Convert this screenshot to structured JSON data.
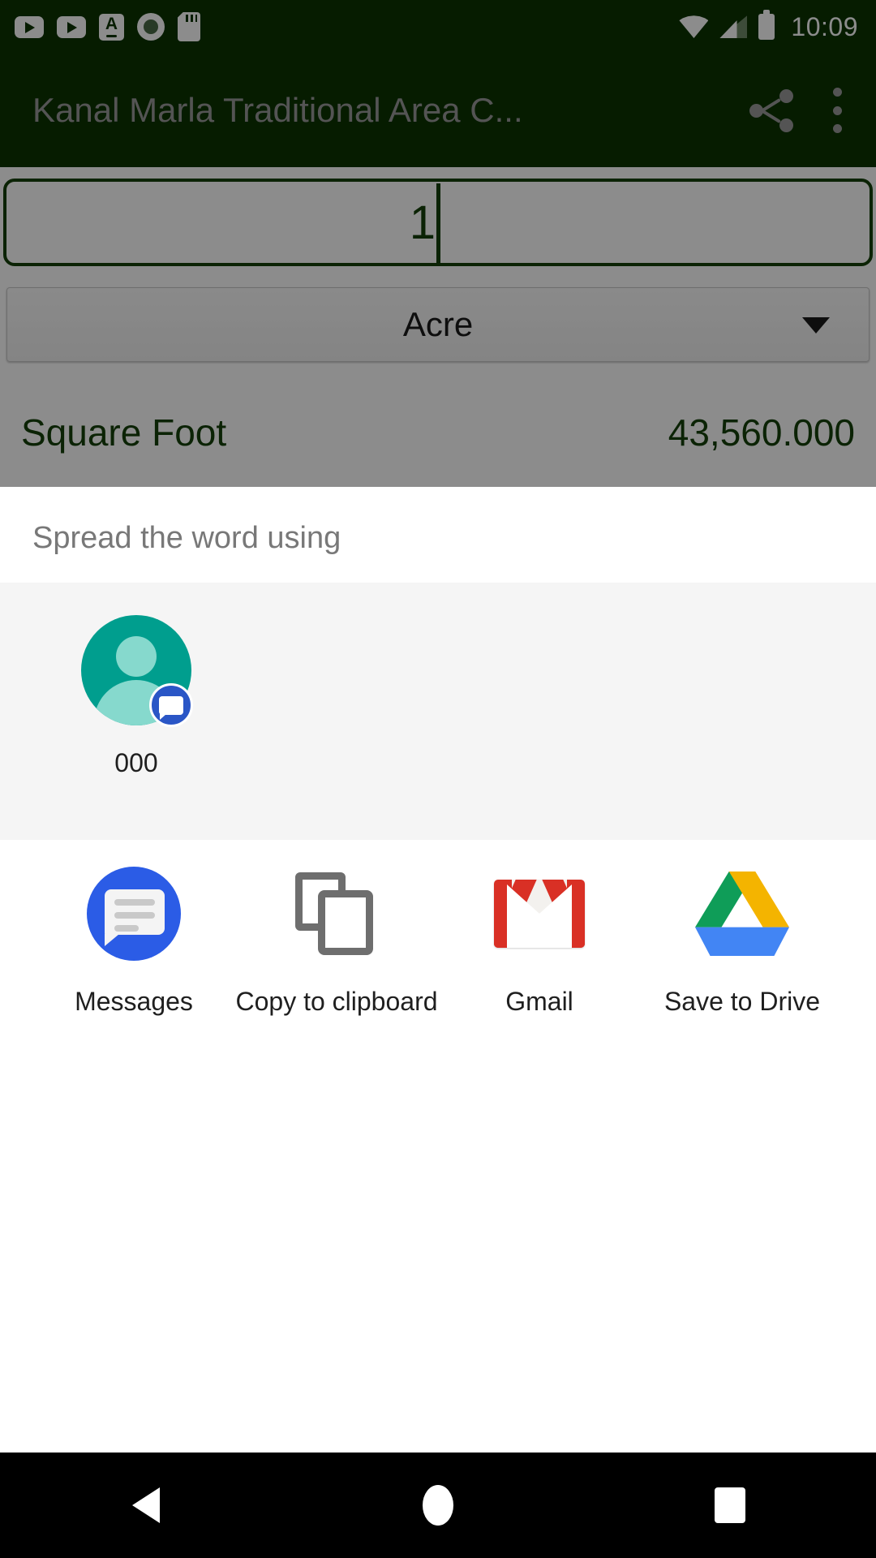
{
  "status_bar": {
    "clock": "10:09",
    "notification_icons": [
      "youtube-play-icon",
      "youtube-play-icon",
      "translate-card-icon",
      "screen-record-icon",
      "sd-card-icon"
    ],
    "system_icons": [
      "wifi-icon",
      "cellular-signal-icon",
      "battery-icon"
    ]
  },
  "app_bar": {
    "title": "Kanal Marla Traditional Area C...",
    "share_icon": "share-icon",
    "overflow_icon": "more-vert-icon"
  },
  "converter": {
    "input_value": "1",
    "unit_selected": "Acre",
    "dropdown_icon": "chevron-down-icon",
    "result_label": "Square Foot",
    "result_value": "43,560.000"
  },
  "share_sheet": {
    "title": "Spread the word using",
    "direct_share": [
      {
        "label": "000",
        "avatar_icon": "contact-avatar-icon",
        "badge_icon": "messages-badge-icon"
      }
    ],
    "targets": [
      {
        "label": "Messages",
        "icon": "messages-icon"
      },
      {
        "label": "Copy to clipboard",
        "icon": "copy-to-clipboard-icon"
      },
      {
        "label": "Gmail",
        "icon": "gmail-icon"
      },
      {
        "label": "Save to Drive",
        "icon": "google-drive-icon"
      }
    ]
  },
  "nav_bar": {
    "back": "back-icon",
    "home": "home-icon",
    "recents": "recents-icon"
  },
  "colors": {
    "app_bar_green": "#0b3300",
    "accent_green": "#14400a",
    "avatar_teal": "#009e8e",
    "messages_blue": "#2b5ce6",
    "gmail_red": "#d93025"
  }
}
